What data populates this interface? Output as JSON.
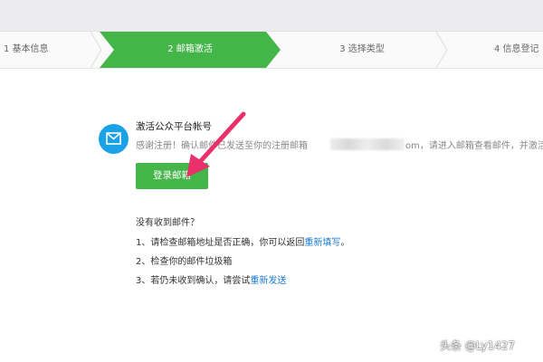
{
  "steps": [
    {
      "label": "1 基本信息"
    },
    {
      "label": "2 邮箱激活"
    },
    {
      "label": "3 选择类型"
    },
    {
      "label": "4 信息登记"
    }
  ],
  "activation": {
    "title": "激活公众平台帐号",
    "desc_prefix": "感谢注册！确认邮件已发送至你的注册邮箱",
    "desc_suffix": "om，请进入邮箱查看邮件，并激活",
    "login_button": "登录邮箱"
  },
  "help": {
    "heading": "没有收到邮件？",
    "item1_text": "1、请检查邮箱地址是否正确，你可以返回",
    "item1_link": "重新填写",
    "item1_end": "。",
    "item2_text": "2、检查你的邮件垃圾箱",
    "item3_text": "3、若仍未收到确认，请尝试",
    "item3_link": "重新发送"
  },
  "watermark": "头条 @Ly1427",
  "colors": {
    "accent_green": "#44b549",
    "mail_blue": "#1aa1e6",
    "link_blue": "#1a7bd6",
    "arrow_pink": "#e8306a"
  }
}
